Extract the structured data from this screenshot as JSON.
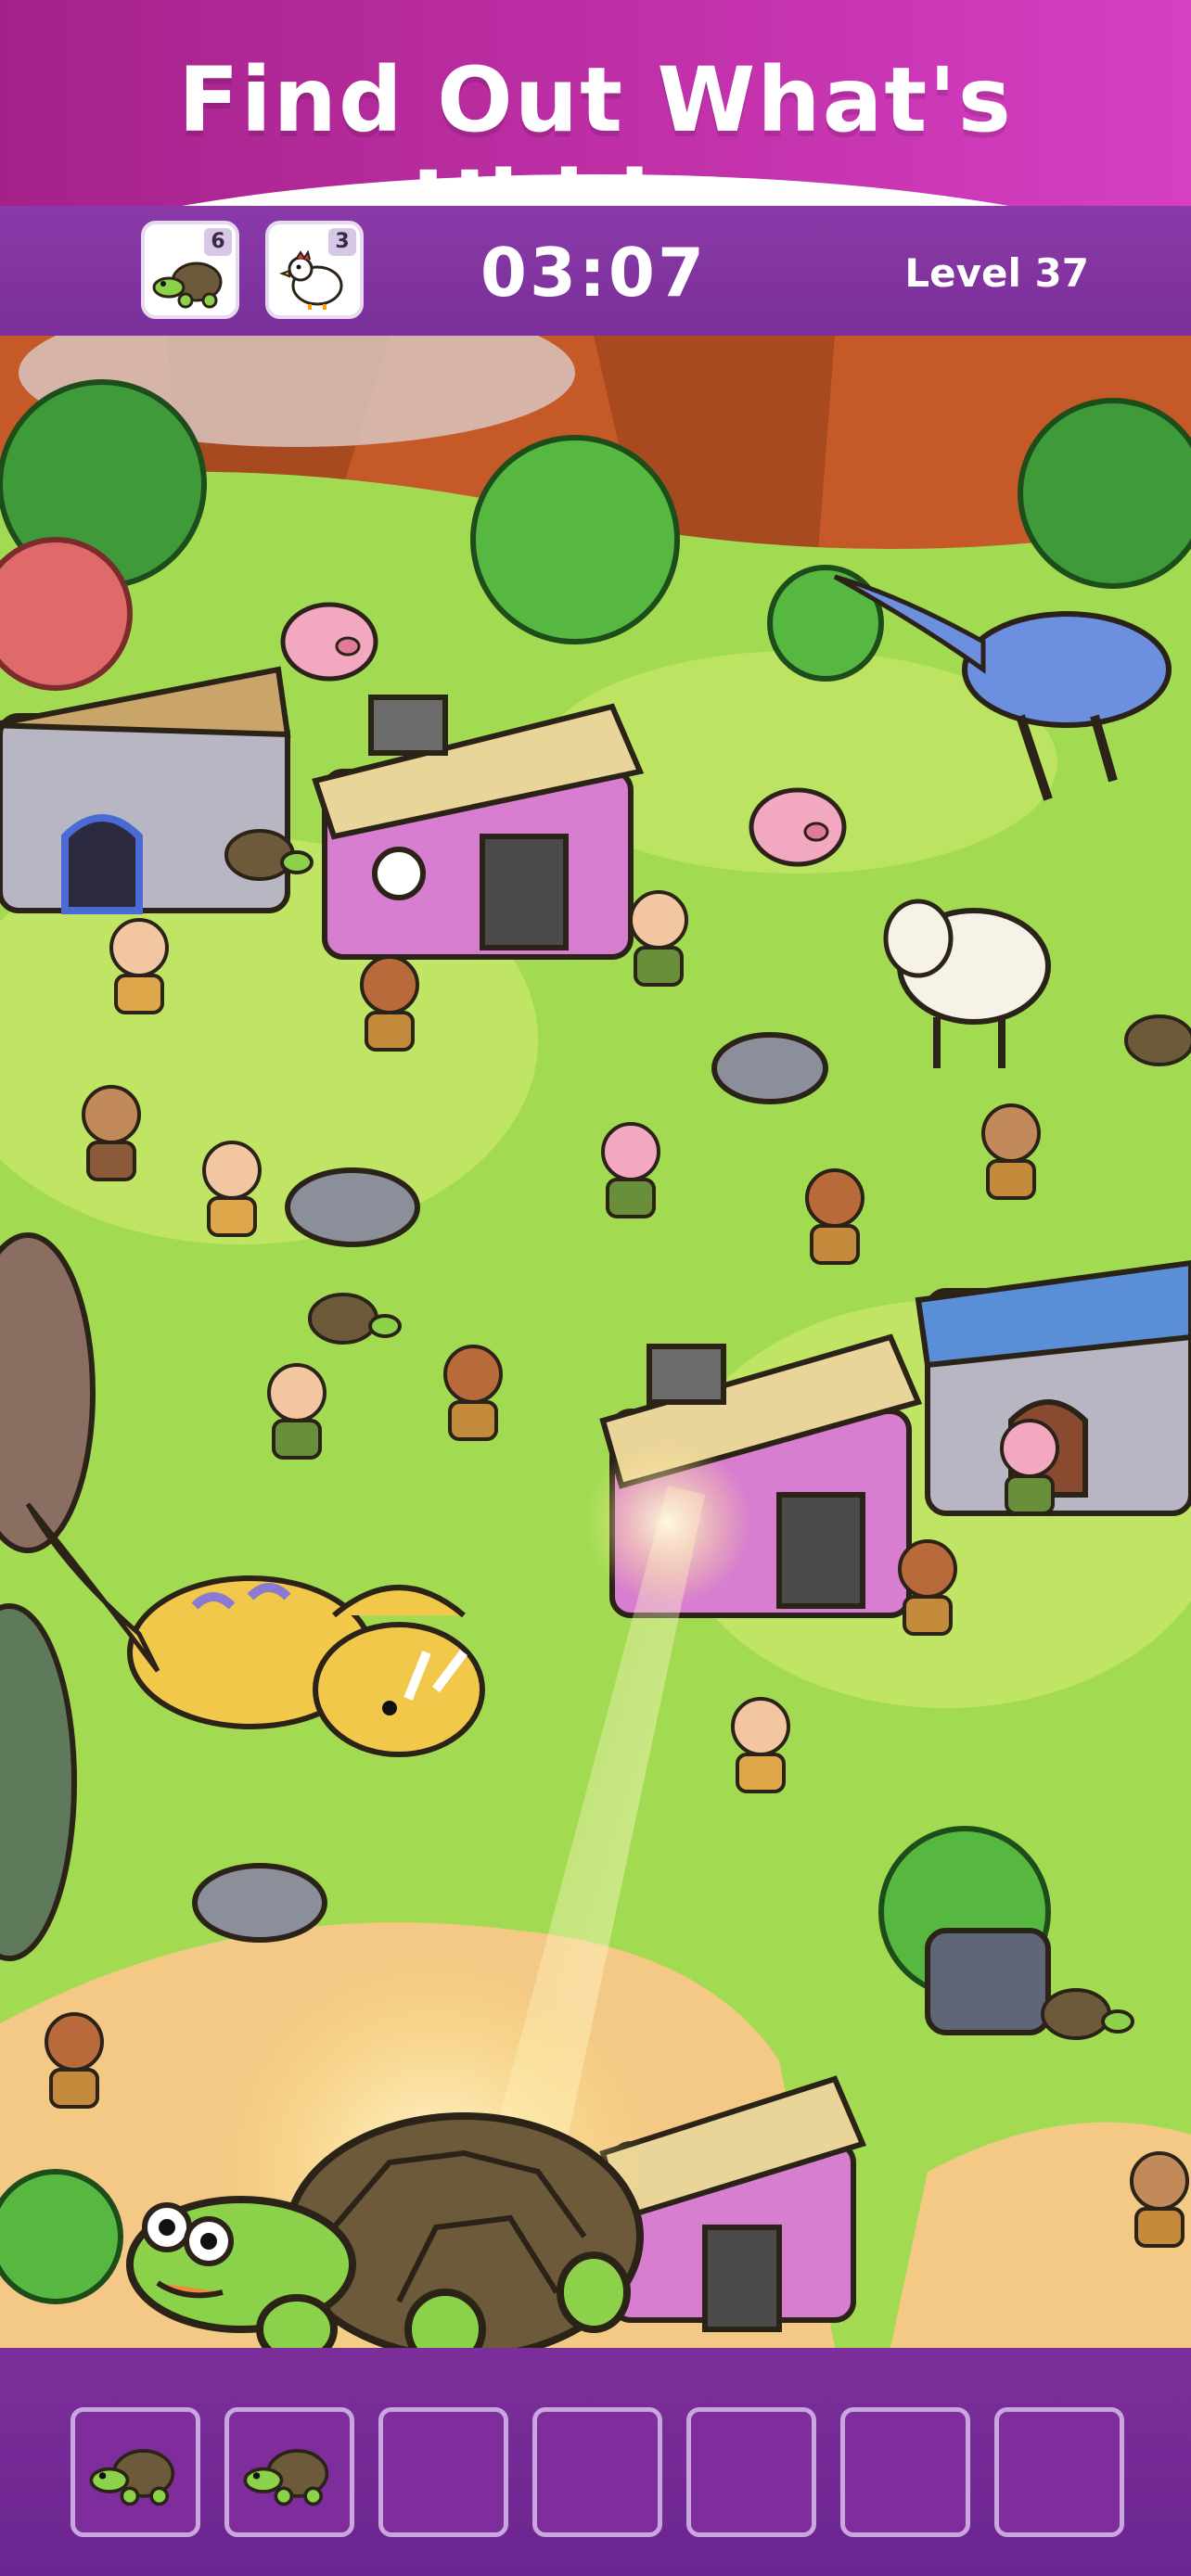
{
  "header": {
    "title": "Find Out What's Hidden"
  },
  "hud": {
    "targets": [
      {
        "name": "turtle-icon",
        "count": "6"
      },
      {
        "name": "chicken-icon",
        "count": "3"
      }
    ],
    "timer": "03:07",
    "level": "Level 37"
  },
  "tray": {
    "slots": [
      {
        "filled": true,
        "item": "turtle"
      },
      {
        "filled": true,
        "item": "turtle"
      },
      {
        "filled": false
      },
      {
        "filled": false
      },
      {
        "filled": false
      },
      {
        "filled": false
      },
      {
        "filled": false
      }
    ]
  },
  "colors": {
    "banner": "#c030a8",
    "hud": "#7a2f9a",
    "grass": "#9dd84c",
    "sand": "#f4c985",
    "tray": "#6b2590"
  }
}
